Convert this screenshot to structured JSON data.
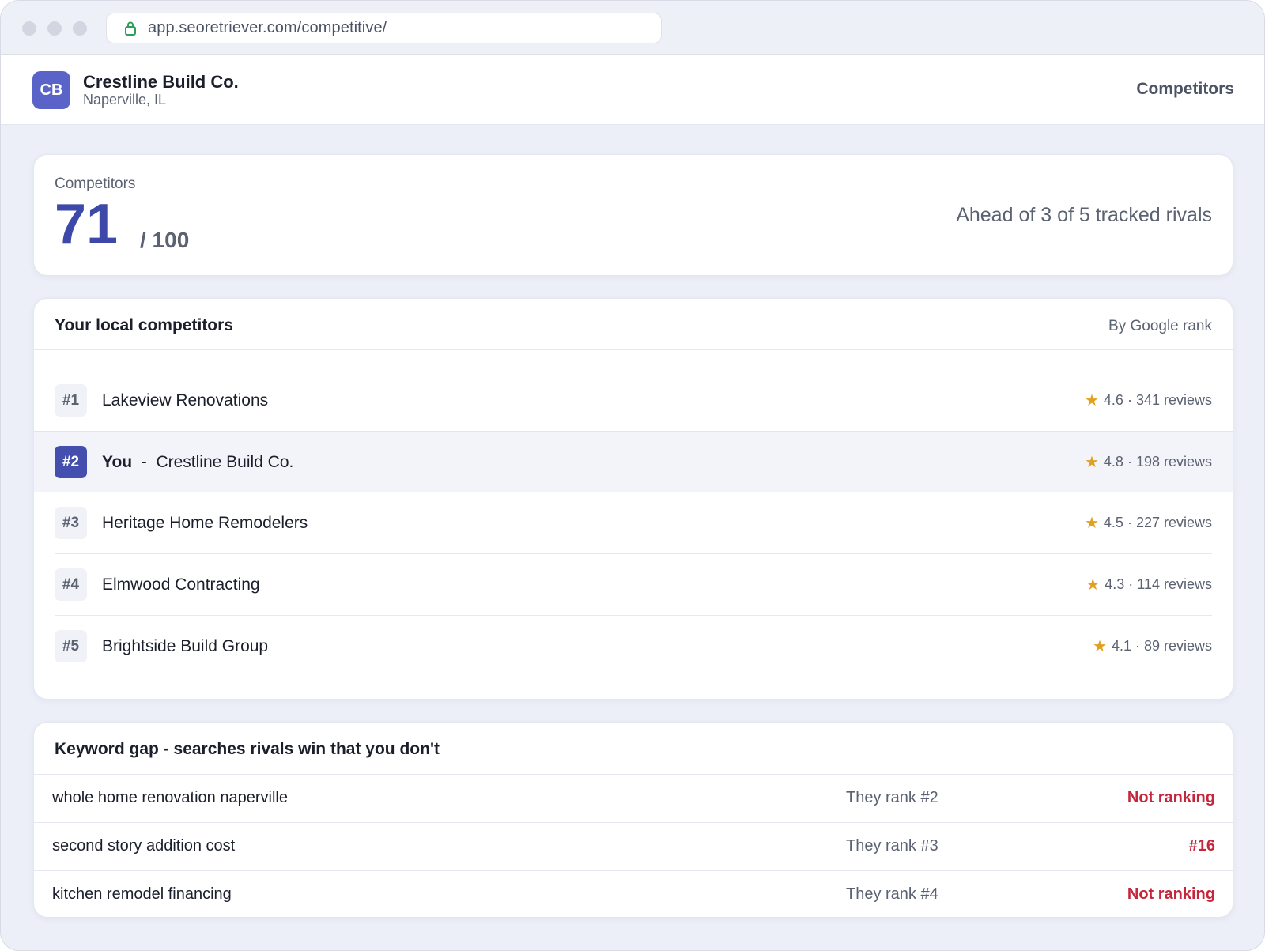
{
  "browser": {
    "url": "app.seoretriever.com/competitive/"
  },
  "header": {
    "avatar_initials": "CB",
    "business_name": "Crestline Build Co.",
    "location": "Naperville, IL",
    "nav_label": "Competitors"
  },
  "score": {
    "label": "Competitors",
    "value": "71",
    "max": "/ 100",
    "summary": "Ahead of 3 of 5 tracked rivals"
  },
  "competitors": {
    "title": "Your local competitors",
    "sort_label": "By Google rank",
    "items": [
      {
        "rank": "#1",
        "name": "Lakeview Renovations",
        "rating": "4.6 · 341 reviews"
      },
      {
        "rank": "#2",
        "you_label": "You",
        "dash": "-",
        "name": "Crestline Build Co.",
        "rating": "4.8 · 198 reviews"
      },
      {
        "rank": "#3",
        "name": "Heritage Home Remodelers",
        "rating": "4.5 · 227 reviews"
      },
      {
        "rank": "#4",
        "name": "Elmwood Contracting",
        "rating": "4.3 · 114 reviews"
      },
      {
        "rank": "#5",
        "name": "Brightside Build Group",
        "rating": "4.1 · 89 reviews"
      }
    ]
  },
  "keyword_gap": {
    "title": "Keyword gap - searches rivals win that you don't",
    "rows": [
      {
        "keyword": "whole home renovation naperville",
        "their_rank": "They rank #2",
        "your_rank": "Not ranking"
      },
      {
        "keyword": "second story addition cost",
        "their_rank": "They rank #3",
        "your_rank": "#16"
      },
      {
        "keyword": "kitchen remodel financing",
        "their_rank": "They rank #4",
        "your_rank": "Not ranking"
      }
    ]
  },
  "colors": {
    "accent": "#434eae",
    "star": "#e0a020",
    "alert": "#c4263b"
  },
  "icons": {
    "lock": "lock-icon",
    "star": "star-icon"
  }
}
